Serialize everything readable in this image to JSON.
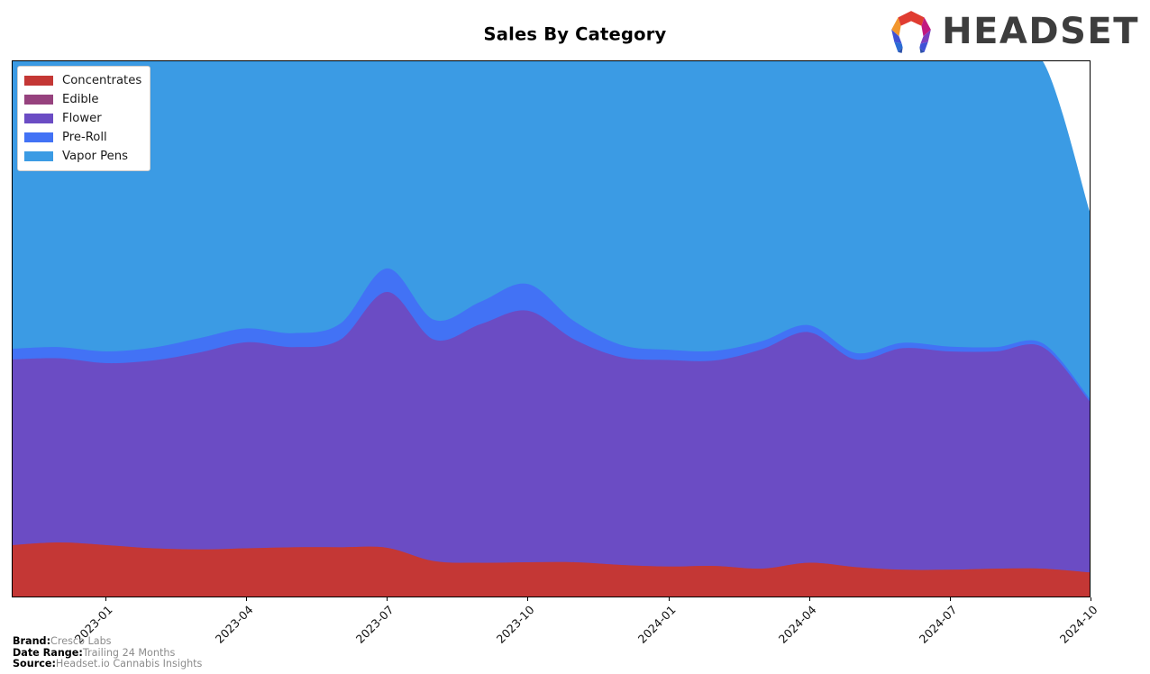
{
  "header": {
    "title": "Sales By Category",
    "logo_text": "HEADSET",
    "logo_icon": "headset-hexagon-logo",
    "logo_colors": [
      "#F2962D",
      "#E03C31",
      "#C2177F",
      "#7B3FBF",
      "#3F51D6",
      "#2B6CD4"
    ]
  },
  "legend": {
    "position": "top-left",
    "items": [
      {
        "label": "Concentrates",
        "color": "#C43735"
      },
      {
        "label": "Edible",
        "color": "#96427E"
      },
      {
        "label": "Flower",
        "color": "#6B4CC4"
      },
      {
        "label": "Pre-Roll",
        "color": "#4272F5"
      },
      {
        "label": "Vapor Pens",
        "color": "#3B9BE4"
      }
    ]
  },
  "footer": {
    "rows": [
      {
        "key": "Brand:",
        "value": "Cresco Labs"
      },
      {
        "key": "Date Range:",
        "value": "Trailing 24 Months"
      },
      {
        "key": "Source:",
        "value": "Headset.io Cannabis Insights"
      }
    ]
  },
  "chart_data": {
    "type": "area",
    "stacked": true,
    "title": "Sales By Category",
    "xlabel": "",
    "ylabel": "",
    "grid": false,
    "y_axis_visible": false,
    "legend_position": "upper left",
    "x": [
      "2022-11",
      "2022-12",
      "2023-01",
      "2023-02",
      "2023-03",
      "2023-04",
      "2023-05",
      "2023-06",
      "2023-07",
      "2023-08",
      "2023-09",
      "2023-10",
      "2023-11",
      "2023-12",
      "2024-01",
      "2024-02",
      "2024-03",
      "2024-04",
      "2024-05",
      "2024-06",
      "2024-07",
      "2024-08",
      "2024-09",
      "2024-10"
    ],
    "xtick_labels": [
      "2023-01",
      "2023-04",
      "2023-07",
      "2023-10",
      "2024-01",
      "2024-04",
      "2024-07",
      "2024-10"
    ],
    "ylim": [
      0,
      100
    ],
    "series": [
      {
        "name": "Concentrates",
        "color": "#C43735",
        "values": [
          9.6,
          10.1,
          9.6,
          9.0,
          8.8,
          9.0,
          9.2,
          9.2,
          9.1,
          6.6,
          6.3,
          6.4,
          6.4,
          5.9,
          5.6,
          5.7,
          5.2,
          6.3,
          5.5,
          5.0,
          5.0,
          5.2,
          5.2,
          4.5
        ]
      },
      {
        "name": "Edible",
        "color": "#96427E",
        "values": [
          0.0,
          0.0,
          0.0,
          0.0,
          0.0,
          0.0,
          0.0,
          0.0,
          0.0,
          0.0,
          0.0,
          0.0,
          0.0,
          0.0,
          0.0,
          0.0,
          0.0,
          0.0,
          0.0,
          0.0,
          0.0,
          0.0,
          0.0,
          0.0
        ]
      },
      {
        "name": "Flower",
        "color": "#6B4CC4",
        "values": [
          34.7,
          34.4,
          34.0,
          35.1,
          36.8,
          38.5,
          37.4,
          38.8,
          47.8,
          41.4,
          44.6,
          47.0,
          41.6,
          38.8,
          38.6,
          38.4,
          41.0,
          43.1,
          38.8,
          41.4,
          40.8,
          40.6,
          41.4,
          32.0
        ]
      },
      {
        "name": "Pre-Roll",
        "color": "#4272F5",
        "values": [
          2.0,
          2.1,
          2.2,
          2.4,
          2.7,
          2.6,
          2.6,
          3.0,
          4.4,
          3.7,
          4.2,
          5.0,
          3.4,
          2.3,
          1.9,
          1.8,
          1.5,
          1.3,
          1.2,
          1.0,
          0.9,
          0.8,
          0.7,
          0.5
        ]
      },
      {
        "name": "Vapor Pens",
        "color": "#3B9BE4",
        "values": [
          53.7,
          53.4,
          54.2,
          53.5,
          51.7,
          49.9,
          50.8,
          49.0,
          38.7,
          48.3,
          44.9,
          41.6,
          48.6,
          53.0,
          53.9,
          54.1,
          52.3,
          49.3,
          54.5,
          52.6,
          53.3,
          53.4,
          52.7,
          35.0
        ]
      }
    ]
  }
}
